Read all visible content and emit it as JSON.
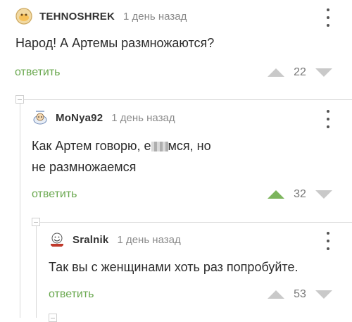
{
  "comments": [
    {
      "author": "TEHNOSHREK",
      "time": "1 день назад",
      "text": "Народ! А Артемы размножаются?",
      "reply": "ответить",
      "votes": "22",
      "upvoted": false
    },
    {
      "author": "MoNya92",
      "time": "1 день назад",
      "text_line1_a": "Как Артем говорю, е",
      "text_line1_b": "мся, но",
      "text_line2": "не размножаемся",
      "reply": "ответить",
      "votes": "32",
      "upvoted": true
    },
    {
      "author": "Sralnik",
      "time": "1 день назад",
      "text": "Так вы с женщинами хоть раз попробуйте.",
      "reply": "ответить",
      "votes": "53",
      "upvoted": false
    }
  ],
  "colors": {
    "accent_green": "#6aa84f",
    "upvote_active": "#7cb55c",
    "muted": "#c9c9c9"
  },
  "icons": [
    "avatar-tehnoshrek",
    "avatar-monya92",
    "avatar-sralnik",
    "more-vert-icon",
    "upvote-arrow-icon",
    "downvote-arrow-icon",
    "collapse-thread-icon"
  ]
}
